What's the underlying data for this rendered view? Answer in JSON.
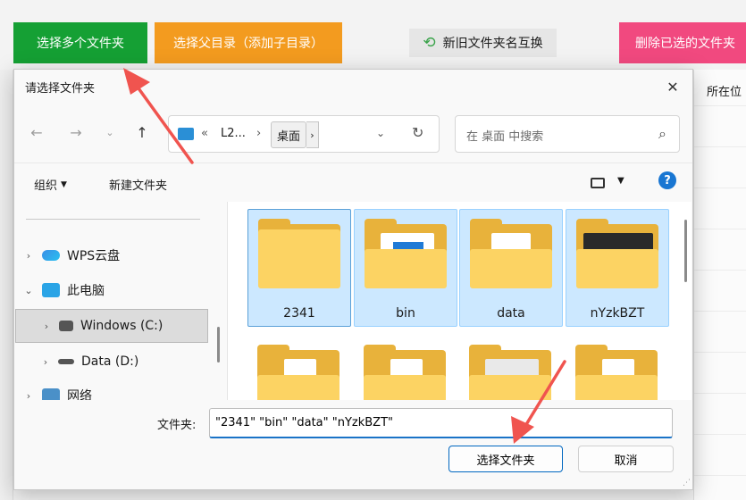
{
  "toolbar": {
    "select_multi": "选择多个文件夹",
    "select_parent": "选择父目录（添加子目录）",
    "swap_names": "新旧文件夹名互换",
    "delete_selected": "删除已选的文件夹"
  },
  "right_panel": {
    "column_header": "所在位"
  },
  "dialog": {
    "title": "请选择文件夹",
    "address": {
      "overflow": "«",
      "segment1": "L2...",
      "sep": "›",
      "current": "桌面"
    },
    "search_placeholder": "在 桌面 中搜索",
    "organize": "组织",
    "new_folder": "新建文件夹",
    "sidebar": [
      {
        "label": "WPS云盘"
      },
      {
        "label": "此电脑"
      },
      {
        "label": "Windows (C:)"
      },
      {
        "label": "Data (D:)"
      },
      {
        "label": "网络"
      }
    ],
    "folders": [
      {
        "label": "2341"
      },
      {
        "label": "bin"
      },
      {
        "label": "data"
      },
      {
        "label": "nYzkBZT"
      }
    ],
    "folder_name_label": "文件夹:",
    "folder_name_value": "\"2341\" \"bin\" \"data\" \"nYzkBZT\"",
    "ok": "选择文件夹",
    "cancel": "取消"
  },
  "colors": {
    "green": "#15a034",
    "orange": "#f39b1f",
    "pink": "#f1497f",
    "accent": "#0067c0",
    "arrow": "#f0544f"
  },
  "icons": [
    "swap-icon",
    "close-icon",
    "back-arrow-icon",
    "forward-arrow-icon",
    "chevron-down-icon",
    "up-arrow-icon",
    "computer-icon",
    "refresh-icon",
    "search-icon",
    "view-icon",
    "help-icon",
    "cloud-icon",
    "monitor-icon",
    "windows-drive-icon",
    "drive-icon",
    "network-icon",
    "folder-icon",
    "annotation-arrow-icon"
  ]
}
